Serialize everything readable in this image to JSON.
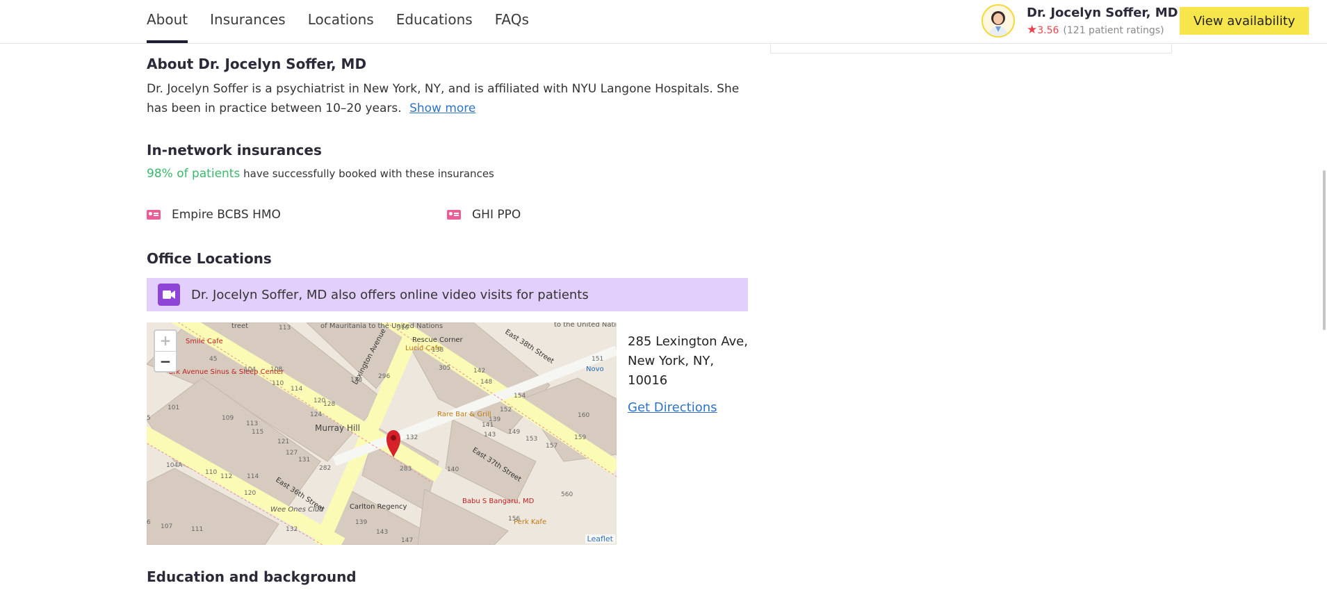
{
  "nav": {
    "tabs": [
      "About",
      "Insurances",
      "Locations",
      "Educations",
      "FAQs"
    ],
    "active_tab": "About"
  },
  "profile": {
    "name": "Dr. Jocelyn Soffer, MD",
    "rating": "3.56",
    "rating_count": "(121 patient ratings)",
    "cta_label": "View availability"
  },
  "about": {
    "heading": "About Dr. Jocelyn Soffer, MD",
    "text": "Dr. Jocelyn Soffer is a psychiatrist in New York, NY, and is affiliated with NYU Langone Hospitals. She has been in practice between 10–20 years.",
    "show_more": "Show more"
  },
  "insurances": {
    "heading": "In-network insurances",
    "pct": "98% of patients",
    "pct_suffix": "have successfully booked with these insurances",
    "items": [
      "Empire BCBS HMO",
      "GHI PPO"
    ]
  },
  "locations": {
    "heading": "Office Locations",
    "video_banner": "Dr. Jocelyn Soffer, MD also offers online video visits for patients",
    "address_line1": "285 Lexington Ave,",
    "address_line2": "New York, NY,",
    "address_line3": "10016",
    "directions": "Get Directions",
    "map": {
      "zoom_in": "+",
      "zoom_out": "−",
      "attribution": "Leaflet",
      "labels": {
        "smile_cafe": "Smile Cafe",
        "park_avenue": "ark Avenue Sinus & Sleep Center",
        "murray_hill": "Murray Hill",
        "east_38th": "East 38th Street",
        "east_37th": "East 37th Street",
        "east_36th": "East 36th Street",
        "lexington": "Lexington Avenue",
        "rescue_corner": "Rescue Corner",
        "lucid_cafe": "Lucid Cafe",
        "rare_bar": "Rare Bar & Grill",
        "carlton_regency": "Carlton Regency",
        "babu": "Babu S Bangaru, MD",
        "perk_kafe": "Perk Kafe",
        "wee_ones": "Wee Ones Club",
        "novo": "Novo",
        "un_mauritania": "of Mauritania to the United Nations",
        "un_right": "to the United Nations",
        "street_top": "treet"
      },
      "numbers": [
        "113",
        "310",
        "45",
        "104",
        "108",
        "110",
        "114",
        "120",
        "124",
        "123",
        "296",
        "128",
        "101",
        "109",
        "113",
        "115",
        "121",
        "127",
        "131",
        "282",
        "104A",
        "110",
        "112",
        "114",
        "120",
        "107",
        "111",
        "132",
        "138",
        "305",
        "142",
        "148",
        "154",
        "152",
        "141",
        "143",
        "139",
        "149",
        "153",
        "157",
        "160",
        "159",
        "560",
        "132",
        "283",
        "140",
        "139",
        "143",
        "147",
        "156",
        "151",
        "6",
        "5"
      ]
    }
  },
  "education": {
    "heading": "Education and background"
  }
}
